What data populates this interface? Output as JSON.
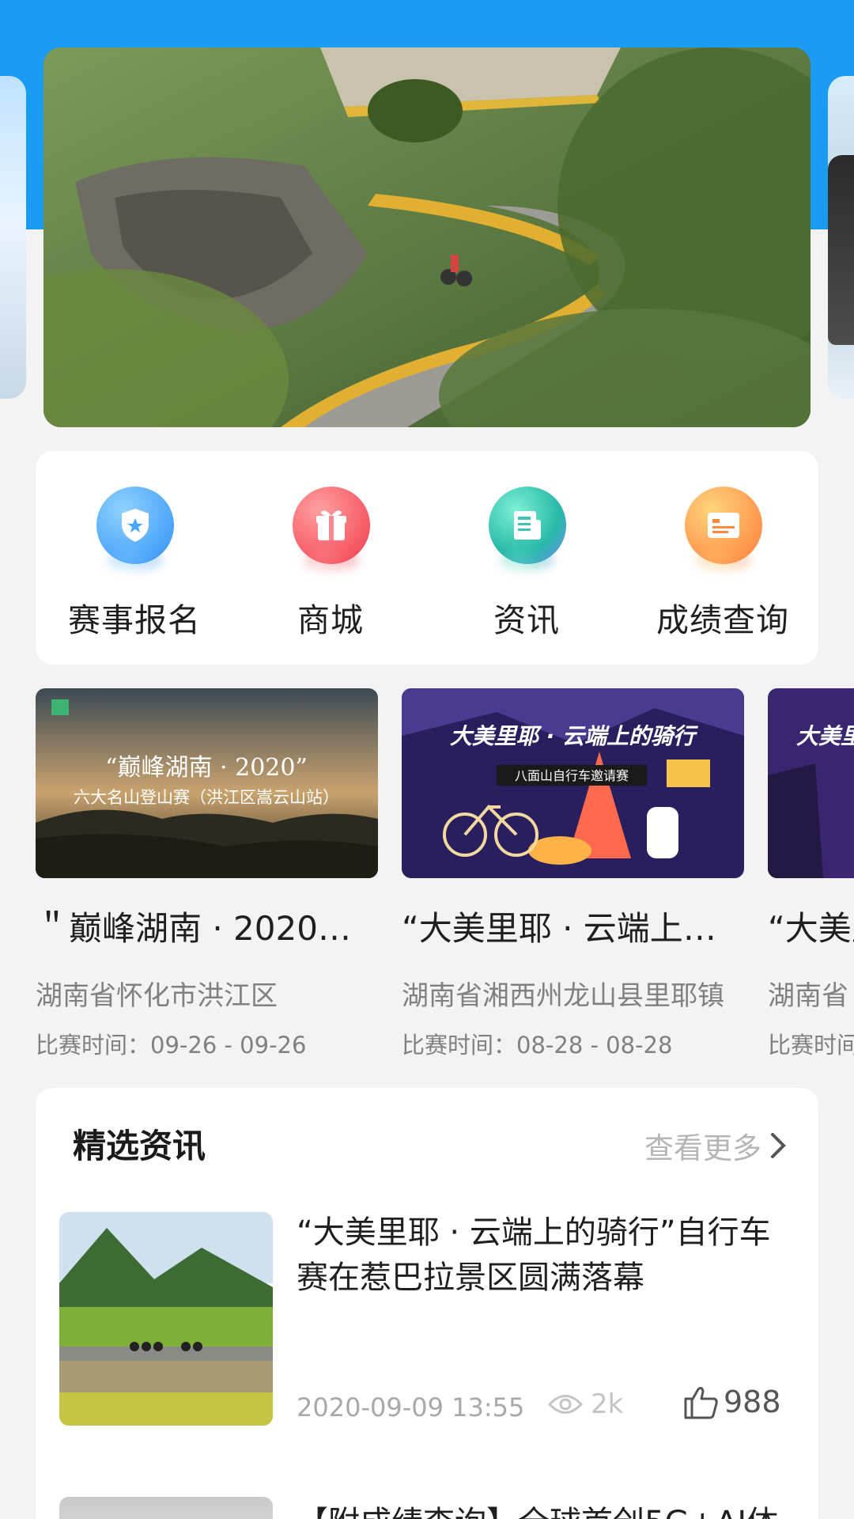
{
  "quick_menu": [
    {
      "label": "赛事报名",
      "icon": "shield-star-icon",
      "color": "#3aa0ff"
    },
    {
      "label": "商城",
      "icon": "gift-icon",
      "color": "#ff5a5a"
    },
    {
      "label": "资讯",
      "icon": "news-icon",
      "color": "#2fd3b4"
    },
    {
      "label": "成绩查询",
      "icon": "card-icon",
      "color": "#ff8a3c"
    }
  ],
  "events": [
    {
      "thumb_heading": "“巅峰湖南 · 2020”",
      "thumb_subheading": "六大名山登山赛（洪江区嵩云山站）",
      "title": "＂巅峰湖南 · 2020＂...",
      "location": "湖南省怀化市洪江区",
      "time": "比赛时间：09-26 - 09-26"
    },
    {
      "thumb_heading": "大美里耶 · 云端上的骑行",
      "thumb_subheading": "八面山自行车邀请赛",
      "title": "“大美里耶 · 云端上的...",
      "location": "湖南省湘西州龙山县里耶镇",
      "time": "比赛时间：08-28 - 08-28"
    },
    {
      "thumb_heading": "大美里",
      "title": "“大美里",
      "location": "湖南省",
      "time": "比赛时间"
    }
  ],
  "news": {
    "heading": "精选资讯",
    "more_label": "查看更多",
    "items": [
      {
        "title": "“大美里耶 · 云端上的骑行”自行车赛在惹巴拉景区圆满落幕",
        "date": "2020-09-09 13:55",
        "views": "2k",
        "likes": "988"
      },
      {
        "title": "【附成绩查询】全球首创5G+AI体"
      }
    ]
  },
  "colors": {
    "top_band": "#1a9cf3",
    "page_bg": "#f3f3f3"
  }
}
